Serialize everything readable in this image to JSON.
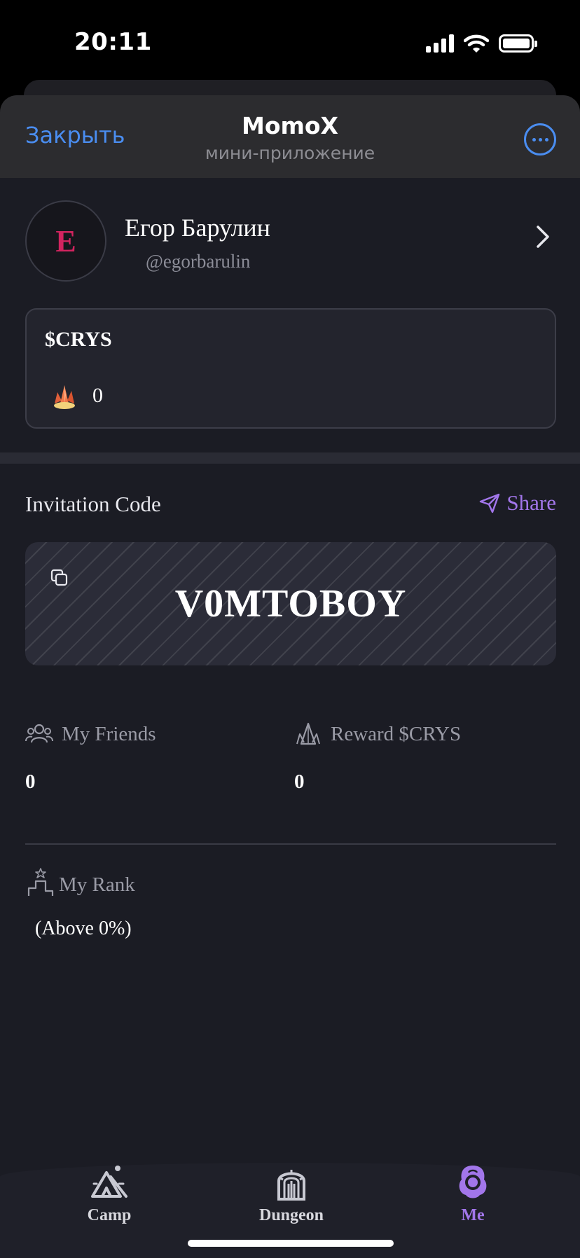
{
  "status_bar": {
    "time": "20:11",
    "icons": [
      "signal-icon",
      "wifi-icon",
      "battery-icon"
    ]
  },
  "header": {
    "close_label": "Закрыть",
    "title": "MomoX",
    "subtitle": "мини-приложение",
    "menu_icon": "more-icon"
  },
  "profile": {
    "avatar_letter": "E",
    "name": "Егор Барулин",
    "handle": "@egorbarulin"
  },
  "balance": {
    "title": "$CRYS",
    "value": "0",
    "icon": "crystal-icon"
  },
  "invite": {
    "label": "Invitation Code",
    "share_label": "Share",
    "code": "V0MTOBOY"
  },
  "stats": {
    "friends": {
      "label": "My Friends",
      "value": "0"
    },
    "reward": {
      "label": "Reward $CRYS",
      "value": "0"
    }
  },
  "rank": {
    "label": "My Rank",
    "value": "(Above 0%)"
  },
  "nav": {
    "items": [
      {
        "label": "Camp"
      },
      {
        "label": "Dungeon"
      },
      {
        "label": "Me",
        "active": true
      }
    ]
  },
  "colors": {
    "accent": "#a276ea",
    "telegram_blue": "#4a8df0",
    "background": "#1b1c24",
    "avatar_letter": "#d2245f"
  }
}
